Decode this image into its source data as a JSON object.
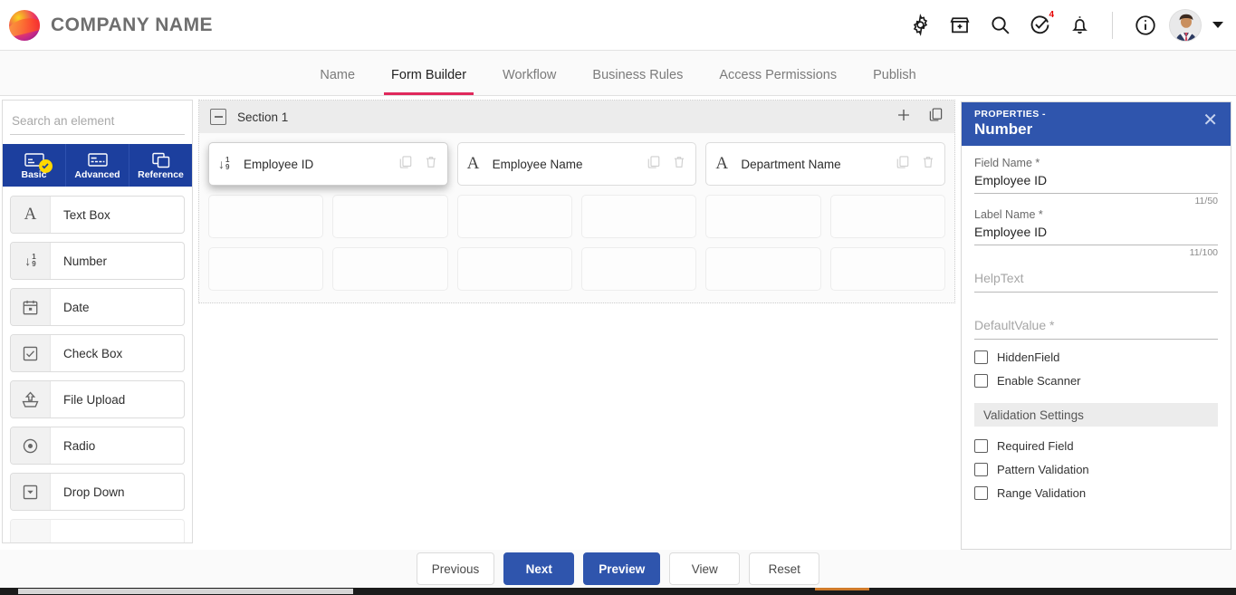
{
  "header": {
    "brand_name": "COMPANY NAME",
    "icons": [
      {
        "name": "gear-icon",
        "label": "Settings"
      },
      {
        "name": "marketplace-icon",
        "label": "Marketplace"
      },
      {
        "name": "search-icon",
        "label": "Search"
      },
      {
        "name": "task-check-icon",
        "label": "Tasks",
        "badge": "4"
      },
      {
        "name": "bell-icon",
        "label": "Notifications"
      },
      {
        "name": "info-icon",
        "label": "Info"
      }
    ],
    "task_badge": "4"
  },
  "tabs": [
    {
      "label": "Name",
      "active": false
    },
    {
      "label": "Form Builder",
      "active": true
    },
    {
      "label": "Workflow",
      "active": false
    },
    {
      "label": "Business Rules",
      "active": false
    },
    {
      "label": "Access Permissions",
      "active": false
    },
    {
      "label": "Publish",
      "active": false
    }
  ],
  "sidebar": {
    "search_placeholder": "Search an element",
    "search_value": "",
    "category_tabs": [
      {
        "label": "Basic",
        "active": true
      },
      {
        "label": "Advanced",
        "active": false
      },
      {
        "label": "Reference",
        "active": false
      }
    ],
    "elements": [
      {
        "label": "Text Box",
        "icon": "letter-a-icon"
      },
      {
        "label": "Number",
        "icon": "number-icon"
      },
      {
        "label": "Date",
        "icon": "calendar-icon"
      },
      {
        "label": "Check Box",
        "icon": "checkbox-icon"
      },
      {
        "label": "File Upload",
        "icon": "upload-icon"
      },
      {
        "label": "Radio",
        "icon": "radio-icon"
      },
      {
        "label": "Drop Down",
        "icon": "dropdown-icon"
      }
    ]
  },
  "canvas": {
    "section_title": "Section 1",
    "section_actions": [
      {
        "name": "add-field-icon",
        "label": "Add"
      },
      {
        "name": "copy-section-icon",
        "label": "Copy"
      }
    ],
    "fields": [
      {
        "label": "Employee ID",
        "icon": "number-icon",
        "selected": true
      },
      {
        "label": "Employee Name",
        "icon": "letter-a-icon",
        "selected": false
      },
      {
        "label": "Department Name",
        "icon": "letter-a-icon",
        "selected": false
      }
    ],
    "empty_slot_rows": 2,
    "empty_slot_cols": 6
  },
  "properties": {
    "kicker": "PROPERTIES -",
    "title": "Number",
    "close_label": "✕",
    "field_name": {
      "label": "Field Name *",
      "value": "Employee ID",
      "counter": "11/50"
    },
    "label_name": {
      "label": "Label Name *",
      "value": "Employee ID",
      "counter": "11/100"
    },
    "help_text": {
      "placeholder": "HelpText",
      "value": ""
    },
    "default_value": {
      "placeholder": "DefaultValue *",
      "value": ""
    },
    "options": [
      {
        "label": "HiddenField",
        "checked": false
      },
      {
        "label": "Enable Scanner",
        "checked": false
      }
    ],
    "validation_header": "Validation Settings",
    "validations": [
      {
        "label": "Required Field",
        "checked": false
      },
      {
        "label": "Pattern Validation",
        "checked": false
      },
      {
        "label": "Range Validation",
        "checked": false
      }
    ]
  },
  "footer": {
    "buttons": [
      {
        "label": "Previous",
        "primary": false
      },
      {
        "label": "Next",
        "primary": true
      },
      {
        "label": "Preview",
        "primary": true
      },
      {
        "label": "View",
        "primary": false
      },
      {
        "label": "Reset",
        "primary": false
      }
    ]
  },
  "colors": {
    "accent_pink": "#e0295c",
    "primary_blue": "#2f55ad",
    "sidebar_tab_blue": "#1c3f9e",
    "badge_yellow": "#ffd800",
    "badge_red": "#e60000"
  }
}
